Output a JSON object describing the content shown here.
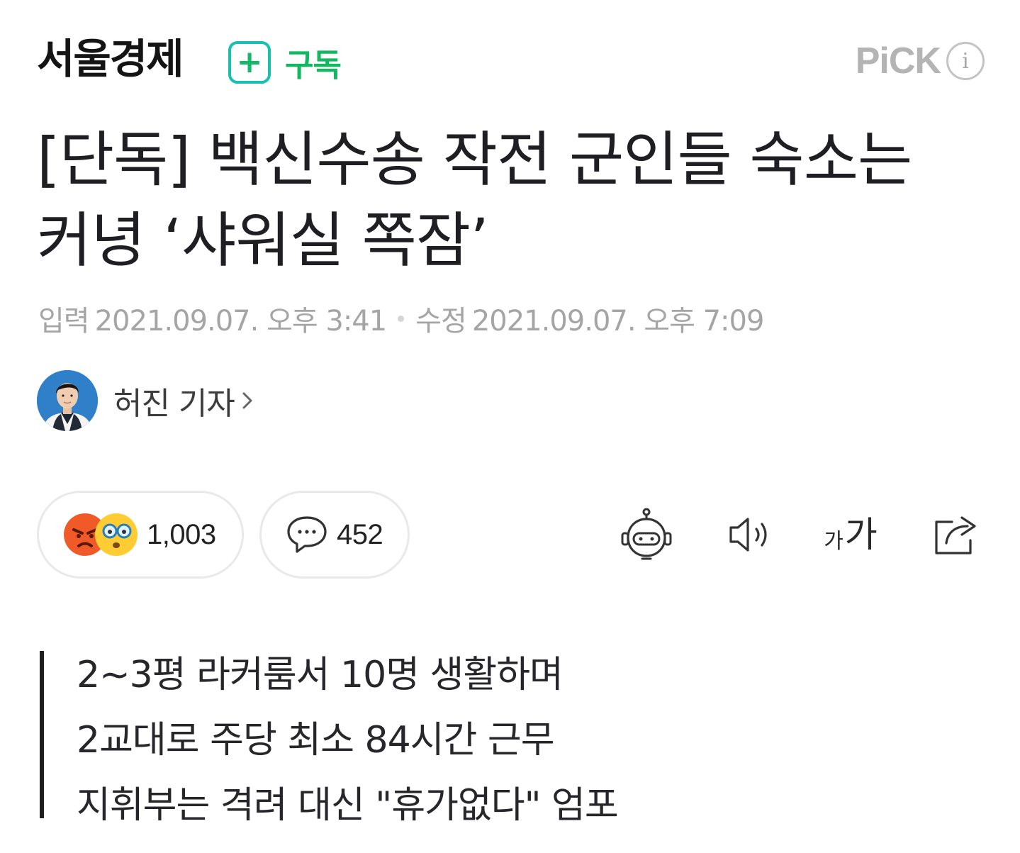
{
  "header": {
    "press_name": "서울경제",
    "subscribe_label": "구독",
    "pick_label": "PiCK",
    "pick_info_glyph": "i"
  },
  "article": {
    "title": "[단독] 백신수송 작전 군인들 숙소는 커녕 ‘샤워실 쪽잠’",
    "published_label": "입력",
    "published_at": "2021.09.07. 오후 3:41",
    "modified_label": "수정",
    "modified_at": "2021.09.07. 오후 7:09",
    "reporter": "허진 기자"
  },
  "actions": {
    "reaction_count": "1,003",
    "comment_count": "452",
    "tools": [
      "summary-bot-icon",
      "text-to-speech-icon",
      "font-size-icon",
      "share-icon"
    ],
    "font_small": "가",
    "font_large": "가"
  },
  "summary": [
    "2~3평 라커룸서 10명 생활하며",
    "2교대로 주당 최소 84시간 근무",
    "지휘부는 격려 대신 \"휴가없다\" 엄포"
  ],
  "colors": {
    "subscribe_green": "#12b85f",
    "subscribe_border": "#17c0b0",
    "meta_gray": "#a5a5a5",
    "angry_face": "#f05a28",
    "surprised_face": "#ffcc33"
  }
}
